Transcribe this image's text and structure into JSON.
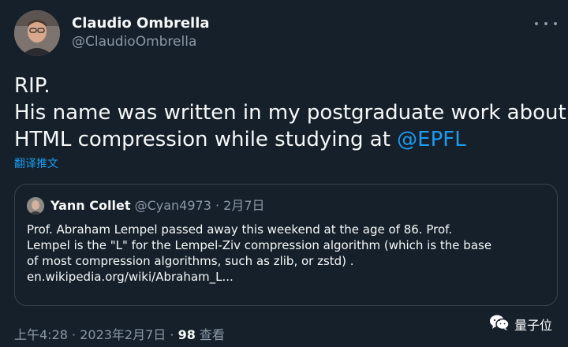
{
  "author": {
    "display_name": "Claudio Ombrella",
    "handle": "@ClaudioOmbrella"
  },
  "tweet": {
    "lines": [
      "RIP.",
      "His name was written in my postgraduate work about",
      "HTML compression while studying at "
    ],
    "mention": "@EPFL",
    "translate": "翻译推文"
  },
  "quoted": {
    "name": "Yann Collet",
    "handle": "@Cyan4973",
    "separator": " · ",
    "date": "2月7日",
    "lines": [
      "Prof. Abraham Lempel passed away this weekend at the age of 86. Prof.",
      "Lempel is the \"L\" for the Lempel-Ziv compression algorithm (which is the base",
      "of most compression algorithms, such as zlib, or zstd) .",
      "en.wikipedia.org/wiki/Abraham_L..."
    ]
  },
  "footer": {
    "time": "上午4:28",
    "separator": " · ",
    "date": "2023年2月7日",
    "separator2": " · ",
    "views_count": "98",
    "views_label": " 查看"
  },
  "watermark": {
    "text": "量子位",
    "icon": "wechat-icon"
  },
  "colors": {
    "background": "#15202b",
    "accent": "#1d9bf0",
    "secondary_text": "#8b98a5",
    "border": "#38444d"
  }
}
